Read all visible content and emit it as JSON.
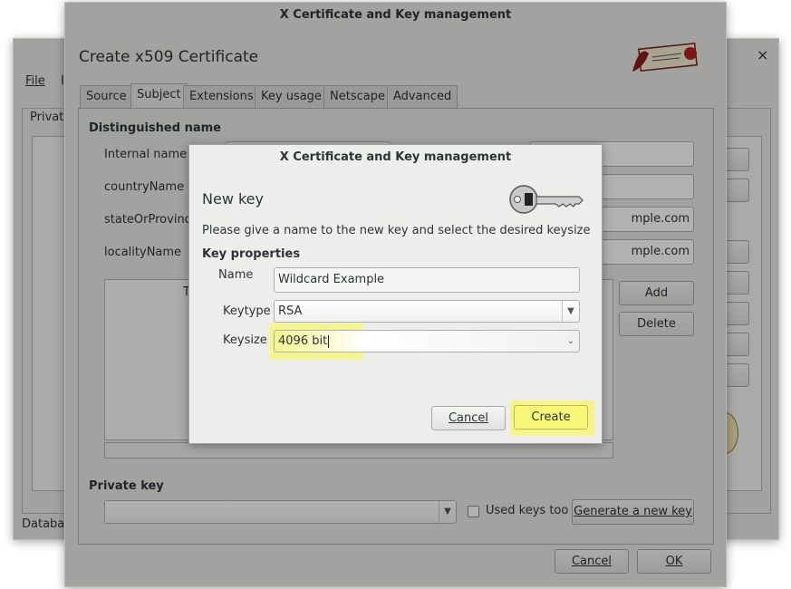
{
  "bg_window": {
    "menu_file": "File",
    "menu_partial": "I",
    "tab_partial": "Private",
    "status_partial": "Databas",
    "close_glyph": "×"
  },
  "create_window": {
    "title": "X Certificate and Key management",
    "heading": "Create x509 Certificate",
    "tabs": [
      "Source",
      "Subject",
      "Extensions",
      "Key usage",
      "Netscape",
      "Advanced"
    ],
    "active_tab": "Subject",
    "section_dn": "Distinguished name",
    "fields": [
      "Internal name",
      "countryName",
      "stateOrProvince",
      "localityName"
    ],
    "right_values": [
      "",
      "",
      "mple.com",
      "mple.com"
    ],
    "table_partial": "T",
    "add_label": "Add",
    "delete_label": "Delete",
    "section_private_key": "Private key",
    "used_keys_label": "Used keys too",
    "generate_label": "Generate a new key",
    "cancel_label": "Cancel",
    "ok_label": "OK"
  },
  "new_key_dialog": {
    "title": "X Certificate and Key management",
    "heading": "New key",
    "description": "Please give a name to the new key and select the desired keysize",
    "section": "Key properties",
    "name_label": "Name",
    "name_value": "Wildcard Example",
    "keytype_label": "Keytype",
    "keytype_value": "RSA",
    "keysize_label": "Keysize",
    "keysize_value": "4096 bit",
    "cancel_label": "Cancel",
    "create_label": "Create"
  },
  "colors": {
    "highlight": "#f5f57a",
    "dialog_bg": "#ededec"
  },
  "icons": [
    "certificate-scroll-icon",
    "key-icon",
    "chevron-down-icon",
    "close-icon"
  ]
}
